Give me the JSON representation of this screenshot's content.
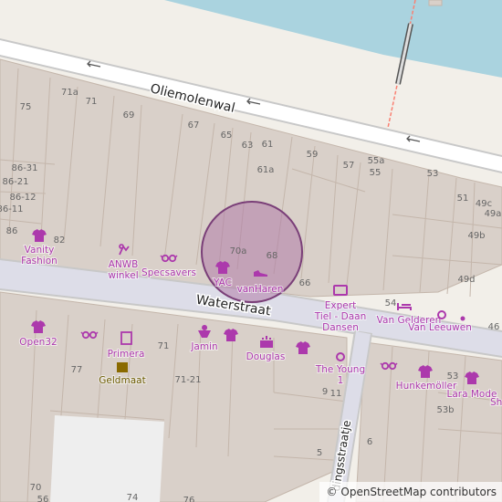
{
  "map": {
    "colors": {
      "background": "#f2efe9",
      "building": "#d9d0c9",
      "building_stroke": "#c4b6ab",
      "water": "#aad3df",
      "road": "#ffffff",
      "road_casing": "#c8c8c8",
      "pedestrian": "#dddde8",
      "footway": "#fa8072",
      "poi": "#ac39ac",
      "housenumber": "#666666",
      "street_label": "#222222",
      "marker_fill": "#b07ca8",
      "marker_stroke": "#7a3f78"
    },
    "streets": [
      "Oliemolenwal",
      "Waterstraat",
      "dingsstraatje"
    ],
    "housenumbers": [
      "71a",
      "71",
      "75",
      "69",
      "67",
      "65",
      "63",
      "61",
      "59",
      "57",
      "55a",
      "55",
      "53",
      "61a",
      "86-31",
      "86-21",
      "86-12",
      "86-11",
      "86",
      "82",
      "51",
      "49c",
      "49a",
      "49b",
      "49d",
      "70a",
      "68",
      "66",
      "54",
      "46",
      "77",
      "71",
      "71-21",
      "53",
      "53b",
      "9",
      "11",
      "5",
      "6",
      "70",
      "56",
      "74",
      "76"
    ],
    "pois": [
      {
        "icon": "clothes-icon",
        "label": "Vanity Fashion"
      },
      {
        "icon": "leisure-icon",
        "label": "ANWB winkel"
      },
      {
        "icon": "optician-icon",
        "label": "Specsavers"
      },
      {
        "icon": "clothes-icon",
        "label": "YAC"
      },
      {
        "icon": "shoes-icon",
        "label": "vanHaren"
      },
      {
        "icon": "electronics-icon",
        "label": "Expert Tiel - Daan Dansen"
      },
      {
        "icon": "furniture-icon",
        "label": "Van Gelderen"
      },
      {
        "icon": "jewelry-icon",
        "label": "Van Leeuwen"
      },
      {
        "icon": "clothes-icon",
        "label": "Open32"
      },
      {
        "icon": "optician-icon",
        "label": ""
      },
      {
        "icon": "books-icon",
        "label": "Primera"
      },
      {
        "icon": "pawnbroker-icon",
        "label": "Geldmaat"
      },
      {
        "icon": "confectionery-icon",
        "label": "Jamin"
      },
      {
        "icon": "clothes-icon",
        "label": ""
      },
      {
        "icon": "cosmetics-icon",
        "label": "Douglas"
      },
      {
        "icon": "clothes-icon",
        "label": ""
      },
      {
        "icon": "jewelry-icon",
        "label": "The Young 1"
      },
      {
        "icon": "optician-icon",
        "label": ""
      },
      {
        "icon": "clothes-icon",
        "label": "Hunkemöller"
      },
      {
        "icon": "clothes-icon",
        "label": "Lara Mode"
      },
      {
        "icon": "clothes-icon",
        "label": "Sh"
      }
    ]
  },
  "attribution": {
    "prefix": "©",
    "link": "OpenStreetMap contributors"
  }
}
